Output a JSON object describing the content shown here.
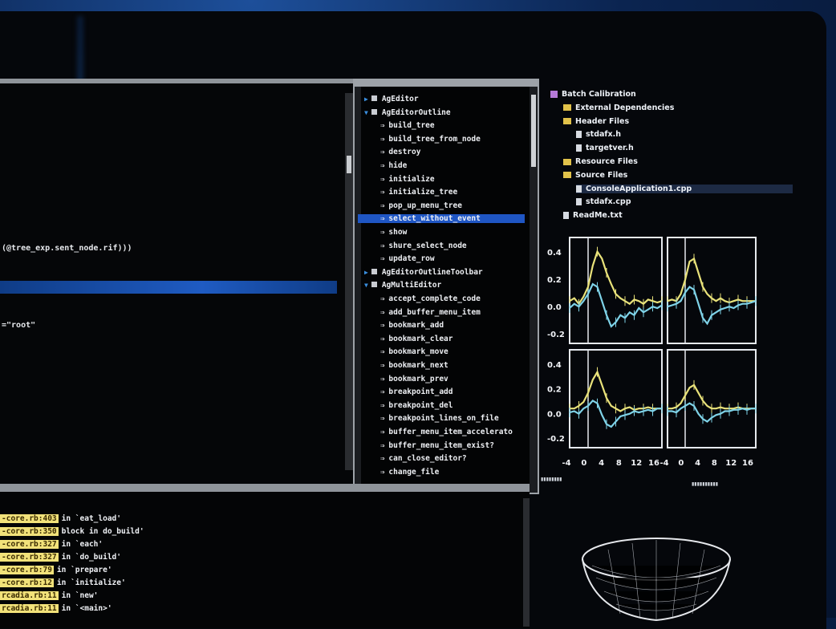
{
  "editor": {
    "lines": [
      "(@tree_exp.sent_node.rif)))",
      "=\"root\""
    ]
  },
  "outline": {
    "items": [
      {
        "label": "AgEditor",
        "kind": "class",
        "expanded": false
      },
      {
        "label": "AgEditorOutline",
        "kind": "class",
        "expanded": true
      },
      {
        "label": "build_tree",
        "kind": "method"
      },
      {
        "label": "build_tree_from_node",
        "kind": "method"
      },
      {
        "label": "destroy",
        "kind": "method"
      },
      {
        "label": "hide",
        "kind": "method"
      },
      {
        "label": "initialize",
        "kind": "method"
      },
      {
        "label": "initialize_tree",
        "kind": "method"
      },
      {
        "label": "pop_up_menu_tree",
        "kind": "method"
      },
      {
        "label": "select_without_event",
        "kind": "method",
        "selected": true
      },
      {
        "label": "show",
        "kind": "method"
      },
      {
        "label": "shure_select_node",
        "kind": "method"
      },
      {
        "label": "update_row",
        "kind": "method"
      },
      {
        "label": "AgEditorOutlineToolbar",
        "kind": "class",
        "expanded": false
      },
      {
        "label": "AgMultiEditor",
        "kind": "class",
        "expanded": true
      },
      {
        "label": "accept_complete_code",
        "kind": "method"
      },
      {
        "label": "add_buffer_menu_item",
        "kind": "method"
      },
      {
        "label": "bookmark_add",
        "kind": "method"
      },
      {
        "label": "bookmark_clear",
        "kind": "method"
      },
      {
        "label": "bookmark_move",
        "kind": "method"
      },
      {
        "label": "bookmark_next",
        "kind": "method"
      },
      {
        "label": "bookmark_prev",
        "kind": "method"
      },
      {
        "label": "breakpoint_add",
        "kind": "method"
      },
      {
        "label": "breakpoint_del",
        "kind": "method"
      },
      {
        "label": "breakpoint_lines_on_file",
        "kind": "method"
      },
      {
        "label": "buffer_menu_item_accelerato",
        "kind": "method"
      },
      {
        "label": "buffer_menu_item_exist?",
        "kind": "method"
      },
      {
        "label": "can_close_editor?",
        "kind": "method"
      },
      {
        "label": "change_file",
        "kind": "method"
      }
    ]
  },
  "console": {
    "lines": [
      {
        "file": "-core.rb:403",
        "text": "in `eat_load'"
      },
      {
        "file": "-core.rb:350",
        "text": "block in do_build'"
      },
      {
        "file": "-core.rb:327",
        "text": "in `each'"
      },
      {
        "file": "-core.rb:327",
        "text": "in `do_build'"
      },
      {
        "file": "-core.rb:79",
        "text": "in `prepare'"
      },
      {
        "file": "-core.rb:12",
        "text": "in `initialize'"
      },
      {
        "file": "rcadia.rb:11",
        "text": "in `new'"
      },
      {
        "file": "rcadia.rb:11",
        "text": "in `<main>'"
      }
    ]
  },
  "solution": {
    "items": [
      {
        "label": "Batch Calibration",
        "icon": "project-icon",
        "indent": 1
      },
      {
        "label": "External Dependencies",
        "icon": "folder-icon",
        "indent": 2
      },
      {
        "label": "Header Files",
        "icon": "folder-icon",
        "indent": 2
      },
      {
        "label": "stdafx.h",
        "icon": "file-icon",
        "indent": 3
      },
      {
        "label": "targetver.h",
        "icon": "file-icon",
        "indent": 3
      },
      {
        "label": "Resource Files",
        "icon": "folder-icon",
        "indent": 2
      },
      {
        "label": "Source Files",
        "icon": "folder-icon",
        "indent": 2
      },
      {
        "label": "ConsoleApplication1.cpp",
        "icon": "file-icon",
        "indent": 3,
        "selected": true
      },
      {
        "label": "stdafx.cpp",
        "icon": "file-icon",
        "indent": 3
      },
      {
        "label": "ReadMe.txt",
        "icon": "file-icon",
        "indent": 2
      }
    ]
  },
  "chart_data": {
    "type": "line",
    "panels": 4,
    "x_tick_labels": [
      "-4",
      "0",
      "4",
      "8",
      "12",
      "16",
      "-4",
      "0",
      "4",
      "8",
      "12",
      "16"
    ],
    "y_tick_labels": [
      "0.4",
      "0.2",
      "0.0",
      "-0.2",
      "0.4",
      "0.2",
      "0.0",
      "-0.2"
    ],
    "x": [
      -4,
      -3,
      -2,
      -1,
      0,
      1,
      2,
      3,
      4,
      5,
      6,
      7,
      8,
      9,
      10,
      11,
      12,
      13,
      14,
      15,
      16
    ],
    "series": [
      {
        "color": "#e9e27a",
        "panel": 0,
        "values": [
          0.0,
          0.02,
          -0.02,
          0.03,
          0.1,
          0.25,
          0.35,
          0.3,
          0.2,
          0.12,
          0.05,
          0.02,
          0.0,
          -0.02,
          0.01,
          0.0,
          -0.02,
          0.01,
          0.0,
          -0.01,
          0.0
        ]
      },
      {
        "color": "#7fd3e8",
        "panel": 0,
        "values": [
          -0.05,
          -0.02,
          -0.04,
          0.0,
          0.05,
          0.12,
          0.1,
          0.0,
          -0.1,
          -0.18,
          -0.15,
          -0.1,
          -0.12,
          -0.08,
          -0.1,
          -0.05,
          -0.08,
          -0.06,
          -0.04,
          -0.05,
          -0.03
        ]
      },
      {
        "color": "#e9e27a",
        "panel": 1,
        "values": [
          0.0,
          0.01,
          0.0,
          0.05,
          0.15,
          0.28,
          0.3,
          0.2,
          0.1,
          0.05,
          0.02,
          0.0,
          0.02,
          0.0,
          -0.01,
          0.0,
          0.01,
          0.0,
          0.0,
          0.0,
          0.0
        ]
      },
      {
        "color": "#7fd3e8",
        "panel": 1,
        "values": [
          -0.04,
          -0.03,
          -0.02,
          0.0,
          0.06,
          0.1,
          0.08,
          -0.02,
          -0.12,
          -0.16,
          -0.1,
          -0.08,
          -0.06,
          -0.05,
          -0.04,
          -0.05,
          -0.03,
          -0.02,
          -0.02,
          -0.01,
          0.0
        ]
      },
      {
        "color": "#e9e27a",
        "panel": 2,
        "values": [
          0.0,
          0.0,
          0.02,
          0.05,
          0.12,
          0.22,
          0.28,
          0.18,
          0.08,
          0.02,
          0.0,
          -0.02,
          0.0,
          0.01,
          -0.01,
          0.0,
          0.0,
          0.01,
          0.0,
          0.0,
          0.0
        ]
      },
      {
        "color": "#7fd3e8",
        "panel": 2,
        "values": [
          -0.03,
          -0.02,
          -0.04,
          0.0,
          0.02,
          0.06,
          0.04,
          -0.05,
          -0.12,
          -0.14,
          -0.1,
          -0.06,
          -0.05,
          -0.04,
          -0.02,
          -0.03,
          -0.02,
          -0.01,
          -0.02,
          0.0,
          0.0
        ]
      },
      {
        "color": "#e9e27a",
        "panel": 3,
        "values": [
          0.0,
          0.0,
          0.01,
          0.04,
          0.1,
          0.16,
          0.18,
          0.12,
          0.06,
          0.02,
          0.0,
          0.0,
          0.01,
          0.0,
          0.0,
          0.0,
          0.01,
          0.0,
          0.0,
          0.0,
          0.0
        ]
      },
      {
        "color": "#7fd3e8",
        "panel": 3,
        "values": [
          -0.02,
          -0.02,
          -0.03,
          0.0,
          0.02,
          0.04,
          0.02,
          -0.04,
          -0.08,
          -0.1,
          -0.07,
          -0.05,
          -0.04,
          -0.02,
          -0.02,
          -0.01,
          -0.01,
          0.0,
          -0.01,
          0.0,
          0.0
        ]
      }
    ],
    "ylim": [
      -0.3,
      0.45
    ],
    "xlim": [
      -4,
      16
    ]
  }
}
